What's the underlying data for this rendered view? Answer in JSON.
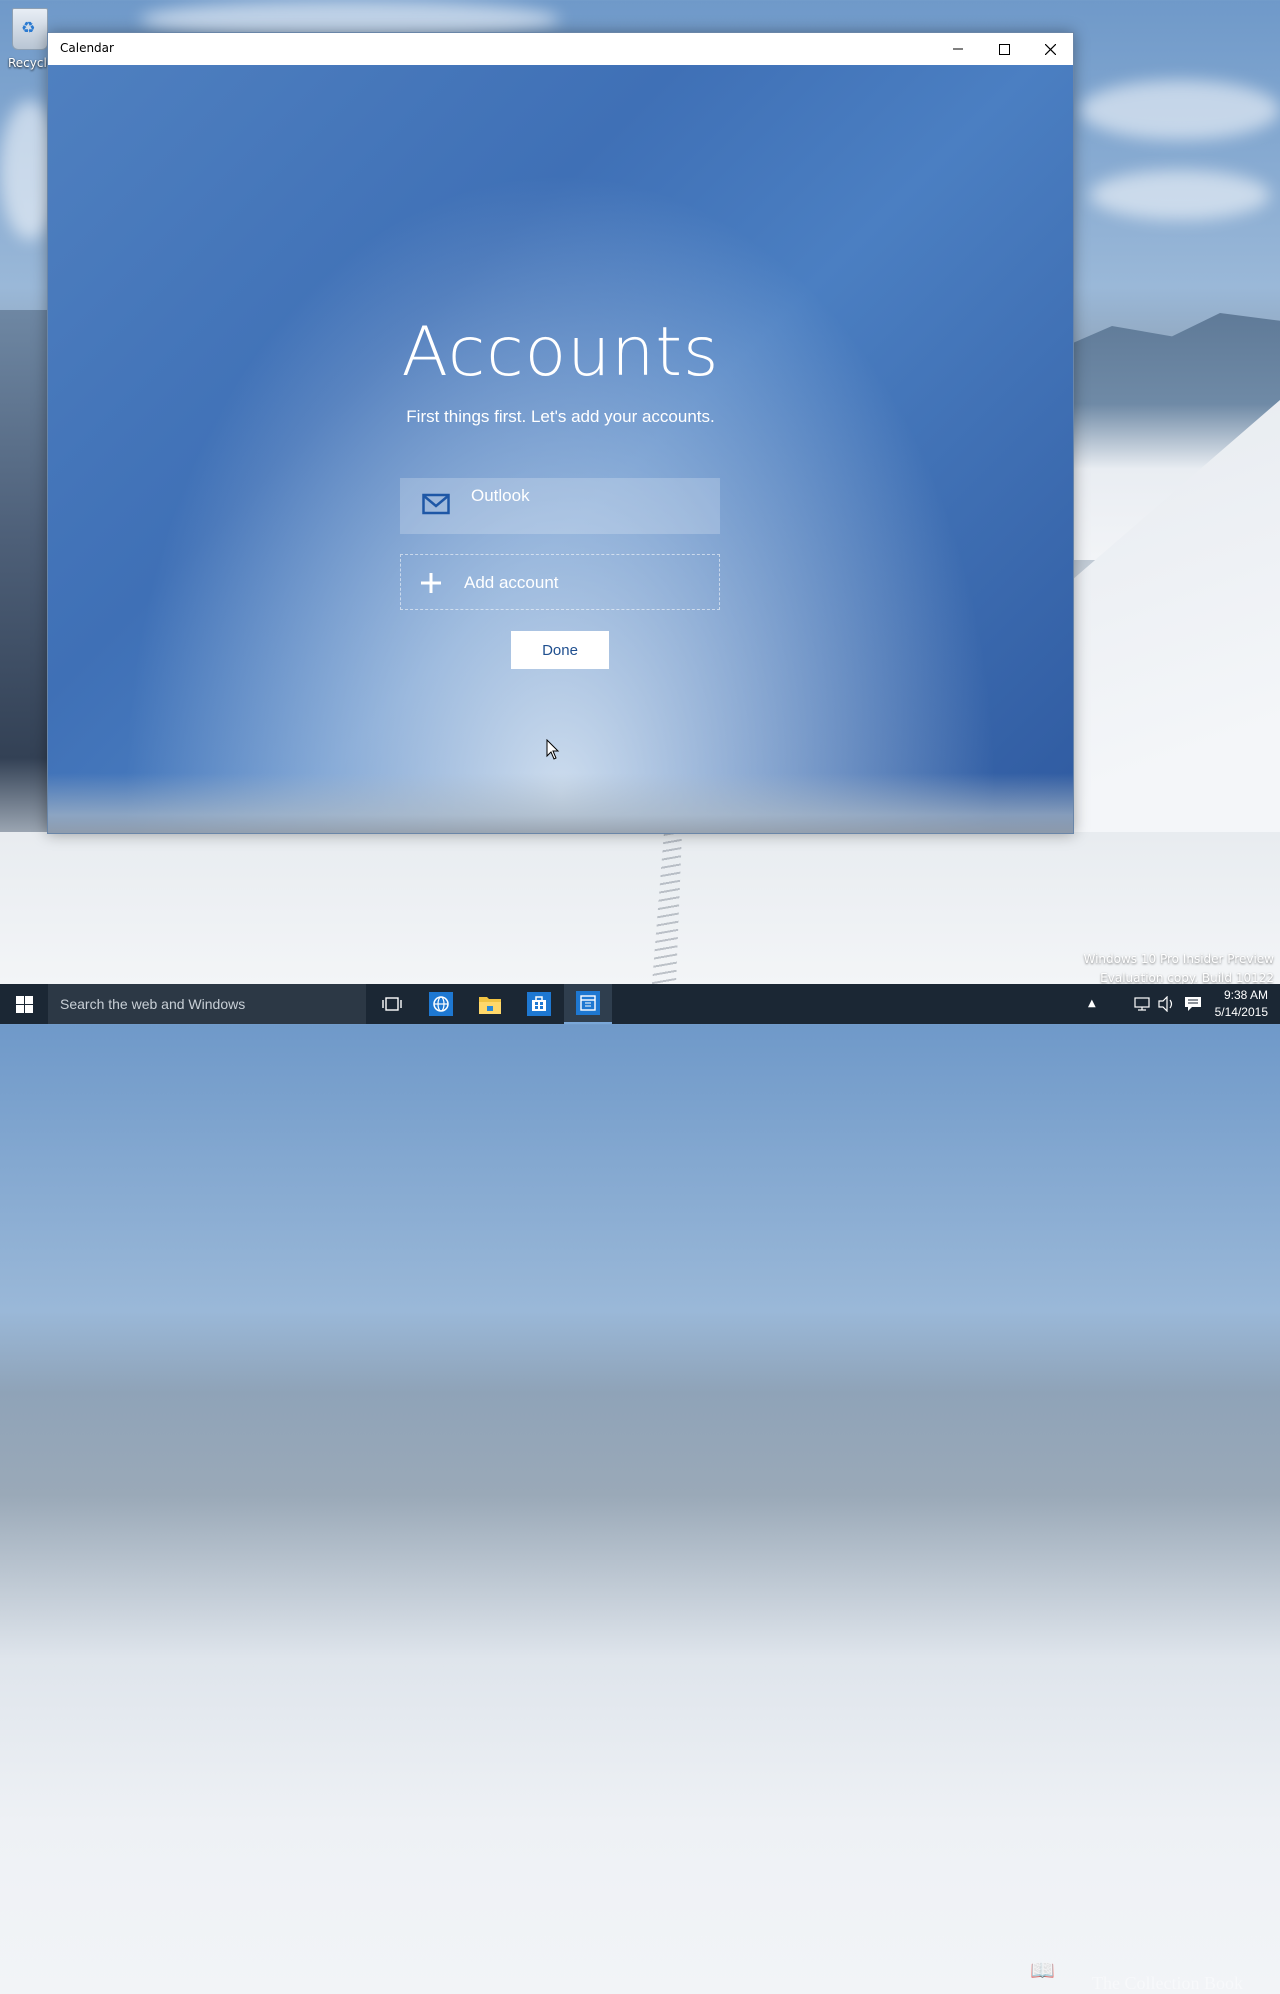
{
  "desktop": {
    "recycle_bin_label": "Recycle",
    "watermark": {
      "line1": "Windows 10 Pro Insider Preview",
      "line2": "Evaluation copy. Build 10122"
    },
    "overlay_text": "The Collection Book"
  },
  "window": {
    "title": "Calendar",
    "controls": [
      "minimize",
      "maximize",
      "close"
    ]
  },
  "accounts_page": {
    "heading": "Accounts",
    "subheading": "First things first. Let's add your accounts.",
    "accounts": [
      {
        "name": "Outlook",
        "icon": "mail-icon"
      }
    ],
    "add_account_label": "Add account",
    "done_label": "Done"
  },
  "taskbar": {
    "search_placeholder": "Search the web and Windows",
    "pinned": [
      "task-view-icon",
      "ie-icon",
      "file-explorer-icon",
      "store-icon",
      "calendar-icon"
    ],
    "active": "calendar-icon",
    "clock": {
      "time": "9:38 AM",
      "date": "5/14/2015"
    }
  },
  "colors": {
    "taskbar": "#1b2734",
    "accent_text": "#1f4f8f",
    "app_bg": "#4a7bbf"
  }
}
